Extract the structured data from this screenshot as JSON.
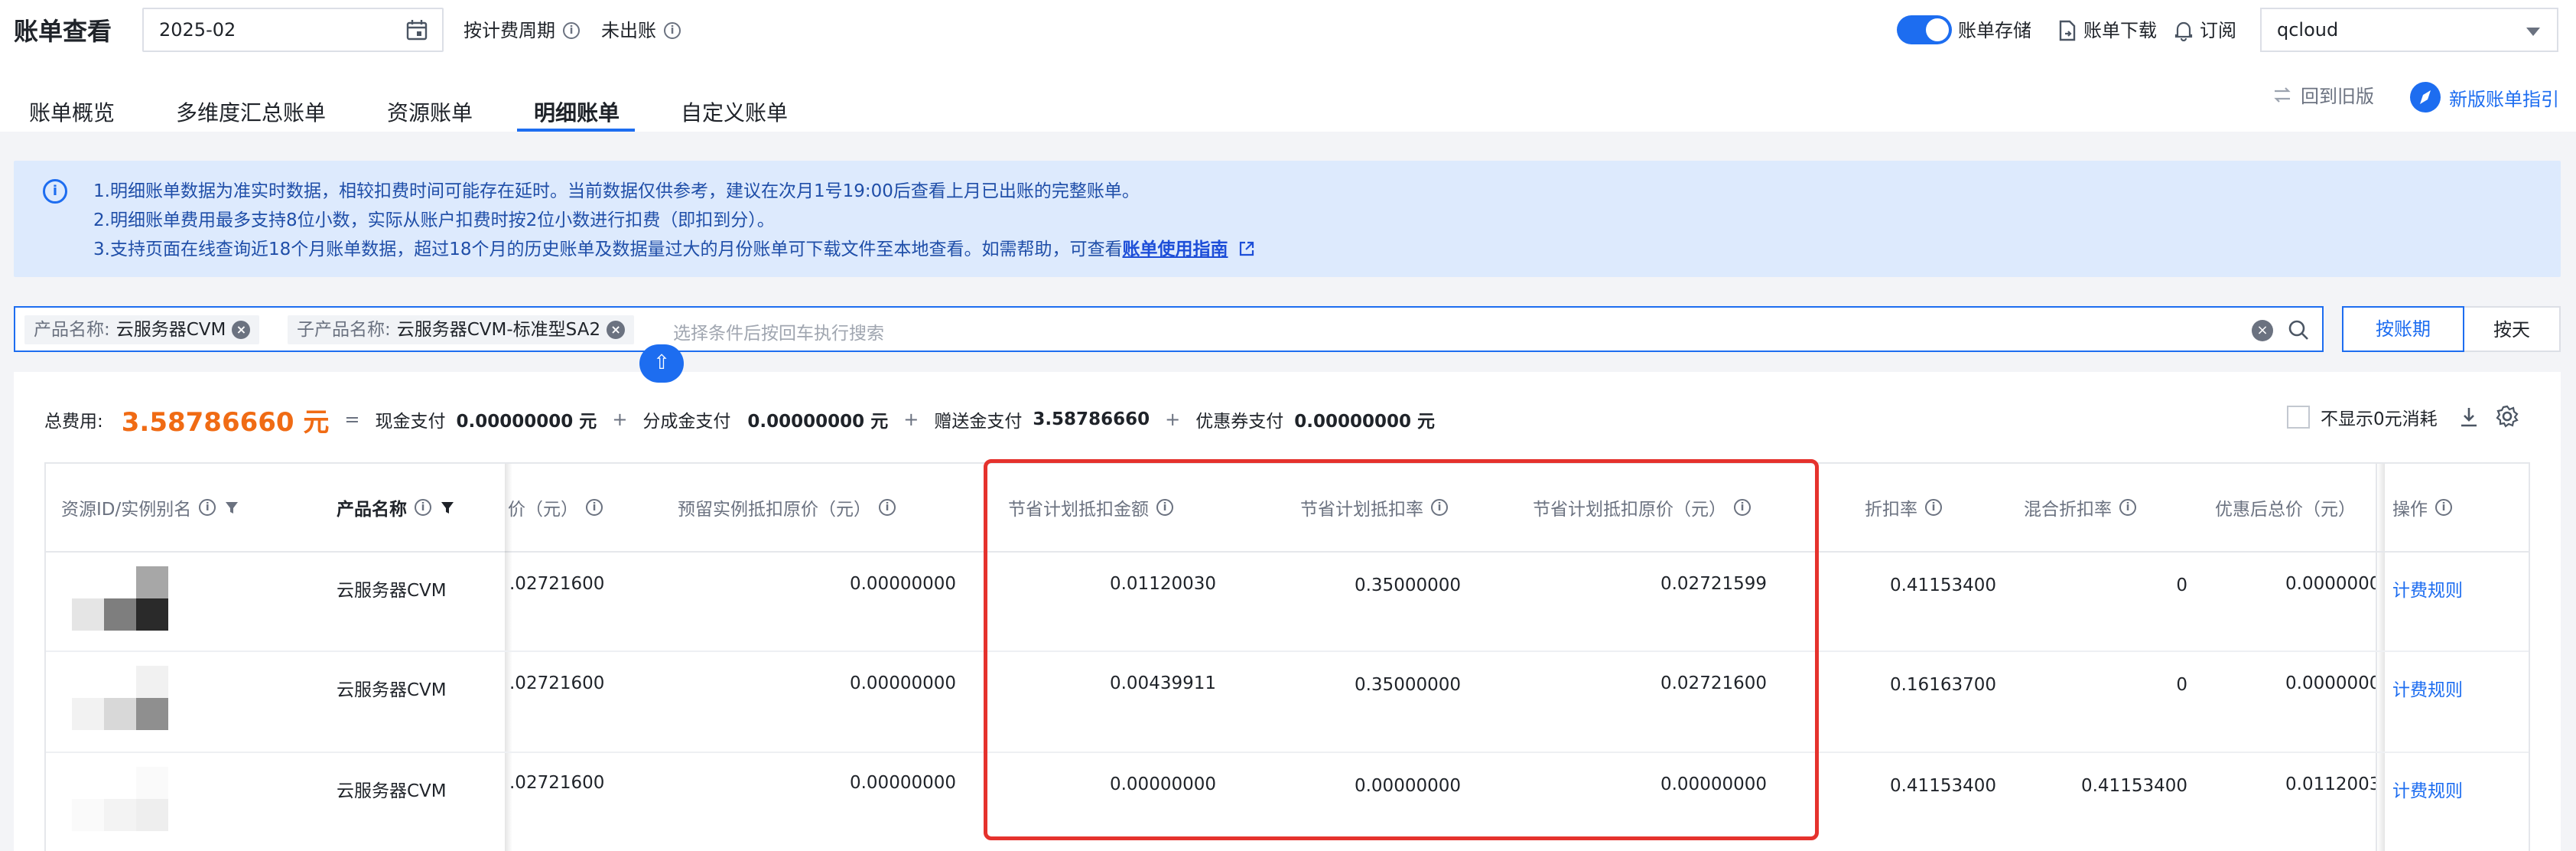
{
  "header": {
    "title": "账单查看",
    "month": "2025-02",
    "by_billing_cycle": "按计费周期",
    "unbilled": "未出账",
    "bill_storage": "账单存储",
    "bill_download": "账单下载",
    "subscribe": "订阅",
    "account": "qcloud"
  },
  "tabs": [
    "账单概览",
    "多维度汇总账单",
    "资源账单",
    "明细账单",
    "自定义账单"
  ],
  "tab_active": "明细账单",
  "back_old": "回到旧版",
  "new_guide": "新版账单指引",
  "notice": {
    "line1": "1.明细账单数据为准实时数据，相较扣费时间可能存在延时。当前数据仅供参考，建议在次月1号19:00后查看上月已出账的完整账单。",
    "line2": "2.明细账单费用最多支持8位小数，实际从账户扣费时按2位小数进行扣费（即扣到分）。",
    "line3": "3.支持页面在线查询近18个月账单数据，超过18个月的历史账单及数据量过大的月份账单可下载文件至本地查看。如需帮助，可查看",
    "guide_link": "账单使用指南"
  },
  "filter": {
    "chip1_key": "产品名称:",
    "chip1_val": "云服务器CVM",
    "chip2_key": "子产品名称:",
    "chip2_val": "云服务器CVM-标准型SA2",
    "placeholder": "选择条件后按回车执行搜索",
    "by_period": "按账期",
    "by_day": "按天"
  },
  "summary": {
    "label": "总费用:",
    "total": "3.58786660 元",
    "eq": "=",
    "cash_label": "现金支付",
    "cash": "0.00000000 元",
    "share_label": "分成金支付",
    "share": "0.00000000 元",
    "gift_label": "赠送金支付",
    "gift": "3.58786660",
    "coupon_label": "优惠券支付",
    "coupon": "0.00000000 元",
    "plus": "+",
    "hide_zero": "不显示0元消耗"
  },
  "table": {
    "headers": {
      "resource_id": "资源ID/实例别名",
      "product": "产品名称",
      "price_partial": "价（元）",
      "reserved": "预留实例抵扣原价（元）",
      "sp_amount": "节省计划抵扣金额",
      "sp_rate": "节省计划抵扣率",
      "sp_original": "节省计划抵扣原价（元）",
      "discount": "折扣率",
      "mixed": "混合折扣率",
      "after_discount": "优惠后总价（元）",
      "ops": "操作"
    },
    "rows": [
      {
        "product": "云服务器CVM",
        "price": ".02721600",
        "reserved": "0.00000000",
        "sp_amount": "0.01120030",
        "sp_rate": "0.35000000",
        "sp_original": "0.02721599",
        "discount": "0.41153400",
        "mixed": "0",
        "after": "0.0000000",
        "op": "计费规则"
      },
      {
        "product": "云服务器CVM",
        "price": ".02721600",
        "reserved": "0.00000000",
        "sp_amount": "0.00439911",
        "sp_rate": "0.35000000",
        "sp_original": "0.02721600",
        "discount": "0.16163700",
        "mixed": "0",
        "after": "0.0000000",
        "op": "计费规则"
      },
      {
        "product": "云服务器CVM",
        "price": ".02721600",
        "reserved": "0.00000000",
        "sp_amount": "0.00000000",
        "sp_rate": "0.00000000",
        "sp_original": "0.00000000",
        "discount": "0.41153400",
        "mixed": "0.41153400",
        "after": "0.0112003",
        "op": "计费规则"
      }
    ]
  },
  "colors": {
    "primary": "#1d6df0",
    "highlight_box": "#e5322d",
    "total": "#f06b14",
    "notice_bg": "#ddeafd"
  }
}
